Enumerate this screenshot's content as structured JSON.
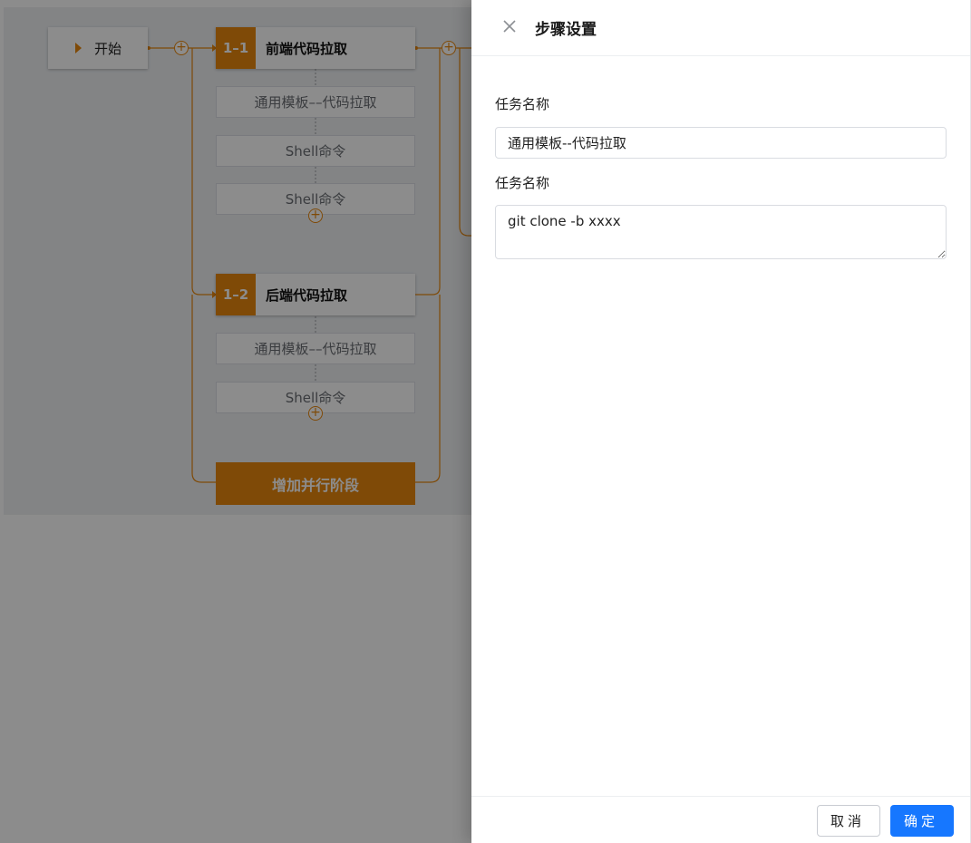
{
  "pipeline": {
    "start_label": "开始",
    "stages": [
      {
        "badge": "1–1",
        "title": "前端代码拉取",
        "steps": [
          "通用模板––代码拉取",
          "Shell命令",
          "Shell命令"
        ]
      },
      {
        "badge": "1–2",
        "title": "后端代码拉取",
        "steps": [
          "通用模板––代码拉取",
          "Shell命令"
        ]
      }
    ],
    "add_parallel_label": "增加并行阶段",
    "plus_symbol": "+",
    "accent_color": "#e8870e"
  },
  "drawer": {
    "title": "步骤设置",
    "field1_label": "任务名称",
    "field1_value": "通用模板--代码拉取",
    "field2_label": "任务名称",
    "field2_value": "git clone -b xxxx",
    "cancel_label": "取消",
    "ok_label": "确定",
    "primary_color": "#1677ff"
  }
}
